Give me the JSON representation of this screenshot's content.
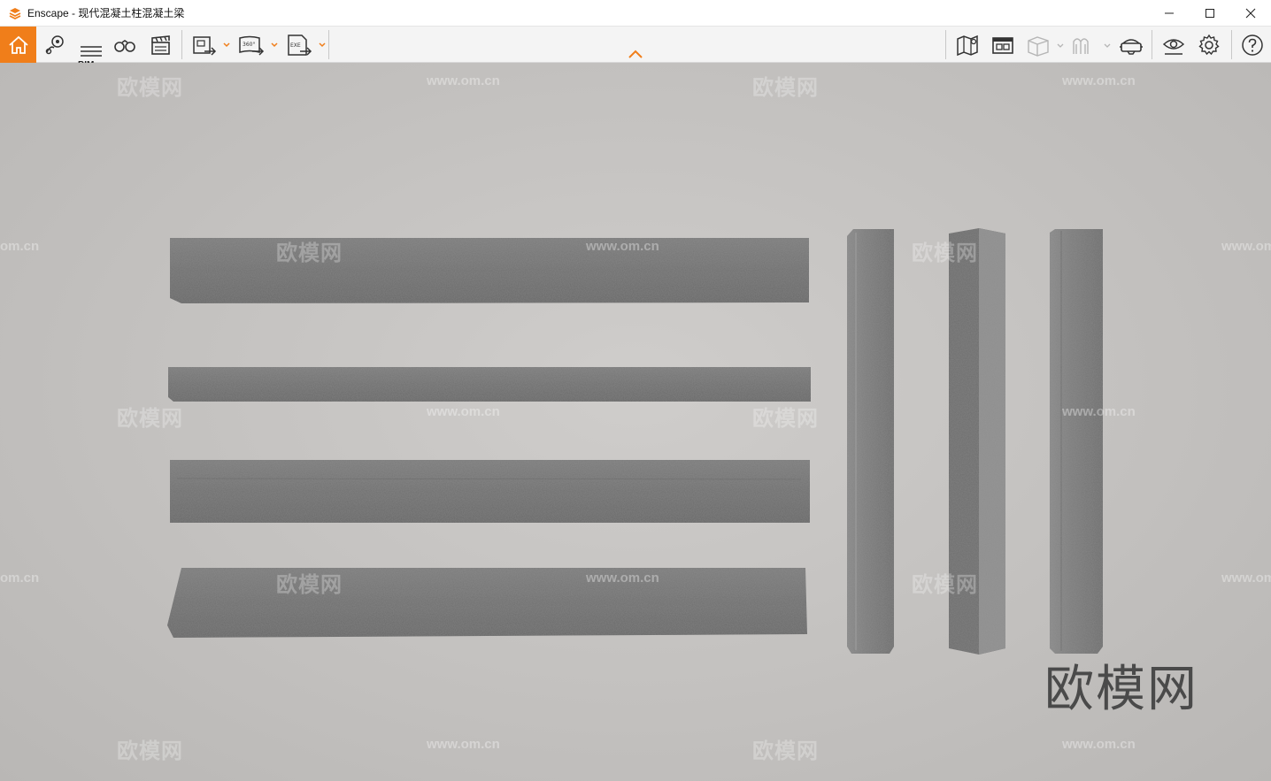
{
  "window": {
    "app_name": "Enscape",
    "separator": " - ",
    "document_title": "现代混凝土柱混凝土梁",
    "minimize": "minimize",
    "maximize": "maximize",
    "close": "close"
  },
  "toolbar": {
    "home_icon": "home-icon",
    "bim_label": "BIM",
    "items": [
      "home",
      "location",
      "bim",
      "binoculars",
      "clapperboard",
      "screenshot-export",
      "panorama-export",
      "exe-export",
      "map",
      "asset-library",
      "view-cube",
      "walkthrough",
      "vr-headset",
      "visual-settings",
      "settings",
      "help"
    ],
    "panorama_label": "360°",
    "exe_label": "EXE",
    "accent_color": "#f07e1a"
  },
  "viewport": {
    "watermark_logo": "欧模网",
    "watermark_url": "www.om.cn",
    "watermark_url_partial": "om.cn",
    "beams": 4,
    "columns": 3
  }
}
